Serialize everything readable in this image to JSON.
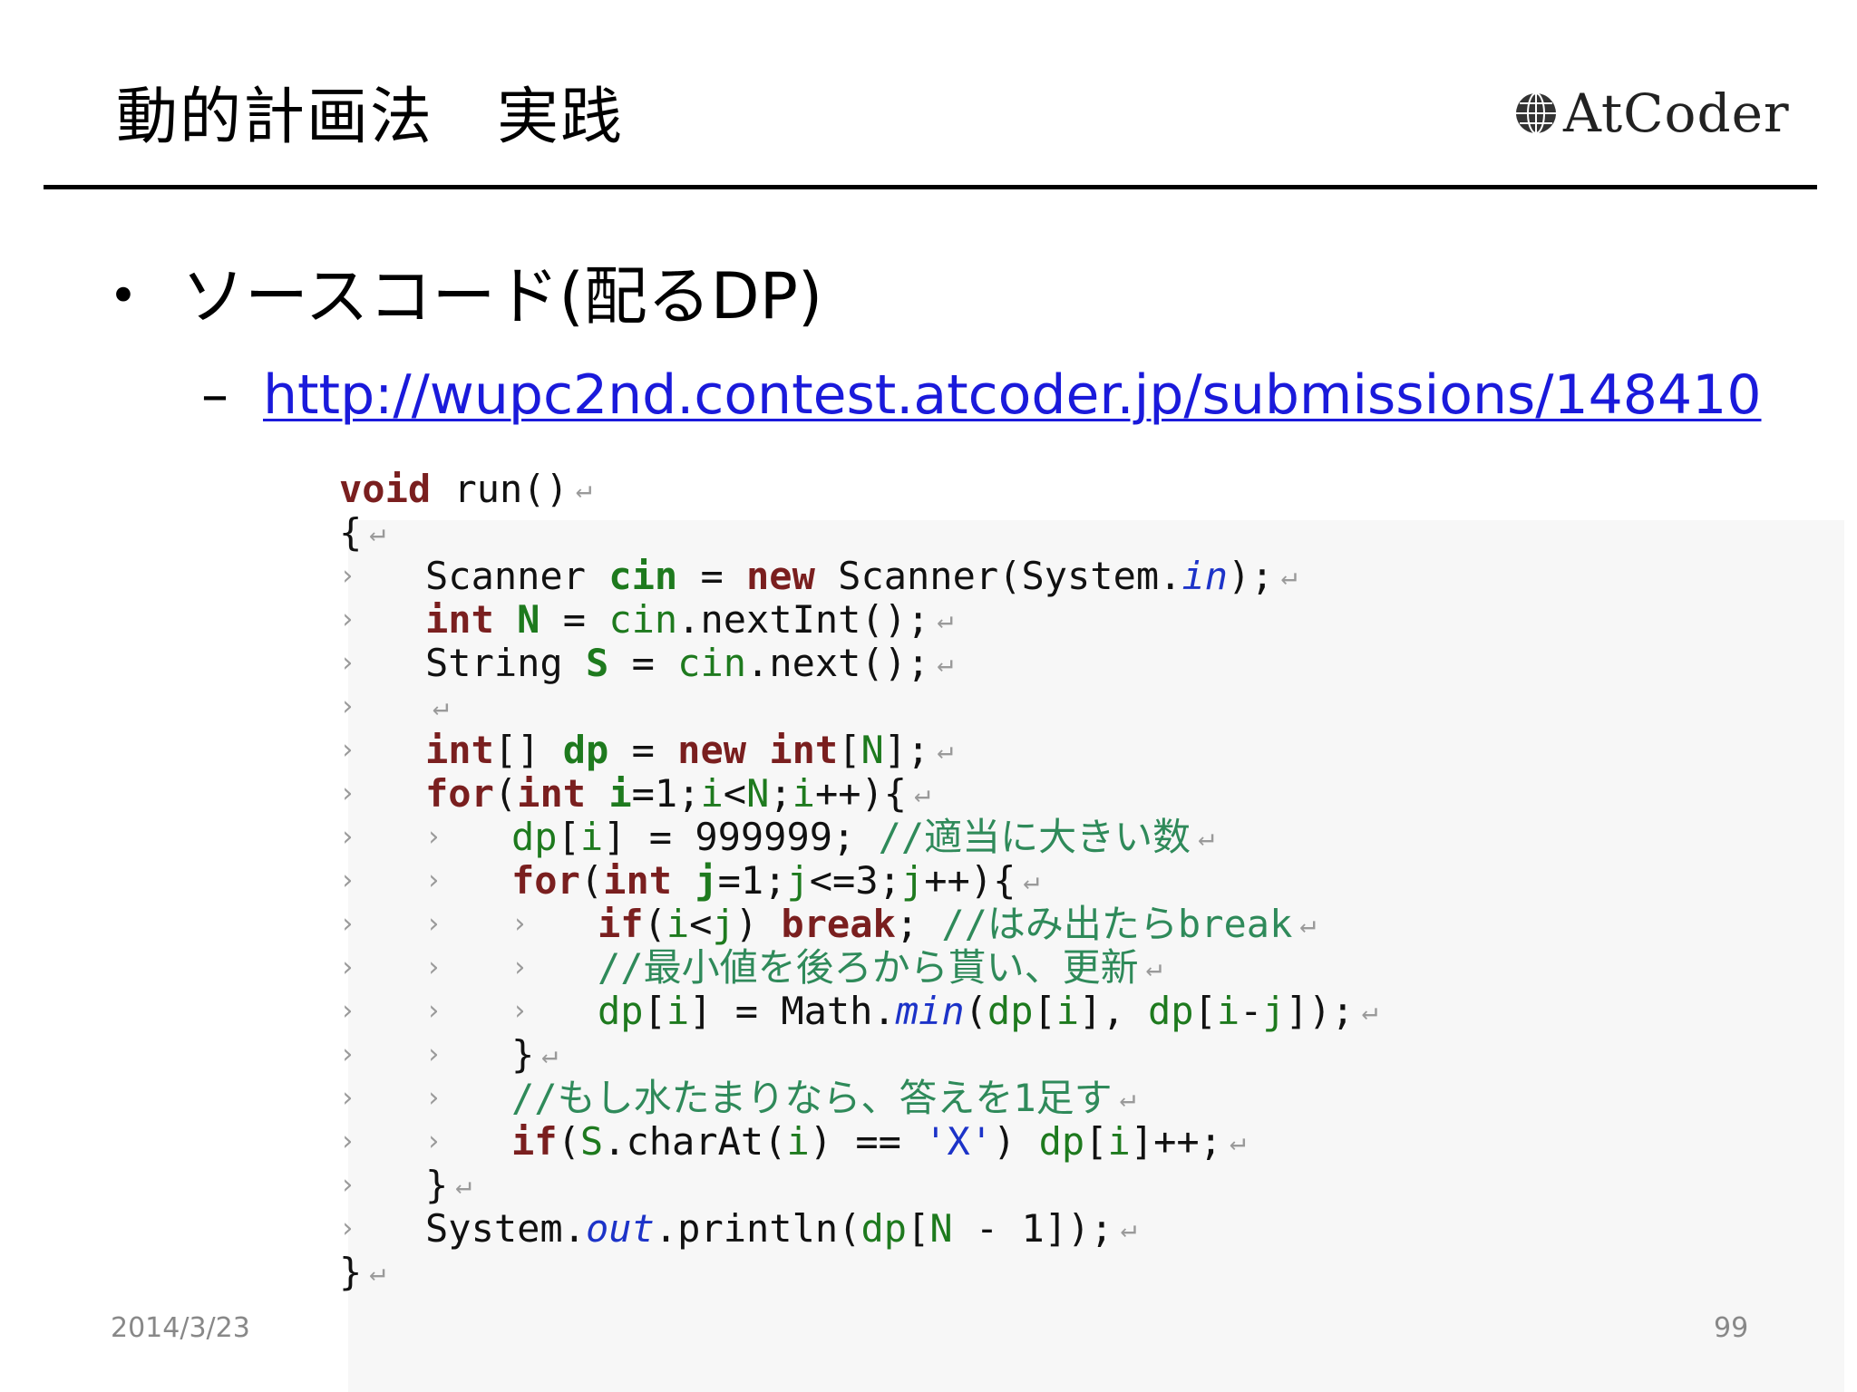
{
  "slide": {
    "title": "動的計画法　実践",
    "logo_text": "AtCoder",
    "bullet": "ソースコード(配るDP)",
    "sub_dash": "–",
    "link": "http://wupc2nd.contest.atcoder.jp/submissions/148410",
    "date": "2014/3/23",
    "page_number": "99"
  },
  "code": {
    "tab_glyph": "›",
    "return_glyph": "↵",
    "lines": [
      {
        "indent": 0,
        "tokens": [
          {
            "t": "void",
            "c": "kw"
          },
          {
            "t": " run()",
            "c": ""
          }
        ]
      },
      {
        "indent": 0,
        "tokens": [
          {
            "t": "{",
            "c": ""
          }
        ]
      },
      {
        "indent": 1,
        "tokens": [
          {
            "t": "Scanner ",
            "c": ""
          },
          {
            "t": "cin",
            "c": "varb"
          },
          {
            "t": " = ",
            "c": ""
          },
          {
            "t": "new",
            "c": "kw"
          },
          {
            "t": " Scanner(System.",
            "c": ""
          },
          {
            "t": "in",
            "c": "stat"
          },
          {
            "t": ");",
            "c": ""
          }
        ]
      },
      {
        "indent": 1,
        "tokens": [
          {
            "t": "int",
            "c": "kw"
          },
          {
            "t": " ",
            "c": ""
          },
          {
            "t": "N",
            "c": "varb"
          },
          {
            "t": " = ",
            "c": ""
          },
          {
            "t": "cin",
            "c": "var"
          },
          {
            "t": ".nextInt();",
            "c": ""
          }
        ]
      },
      {
        "indent": 1,
        "tokens": [
          {
            "t": "String ",
            "c": ""
          },
          {
            "t": "S",
            "c": "varb"
          },
          {
            "t": " = ",
            "c": ""
          },
          {
            "t": "cin",
            "c": "var"
          },
          {
            "t": ".next();",
            "c": ""
          }
        ]
      },
      {
        "indent": 1,
        "tokens": []
      },
      {
        "indent": 1,
        "tokens": [
          {
            "t": "int",
            "c": "kw"
          },
          {
            "t": "[] ",
            "c": ""
          },
          {
            "t": "dp",
            "c": "varb"
          },
          {
            "t": " = ",
            "c": ""
          },
          {
            "t": "new",
            "c": "kw"
          },
          {
            "t": " ",
            "c": ""
          },
          {
            "t": "int",
            "c": "kw"
          },
          {
            "t": "[",
            "c": ""
          },
          {
            "t": "N",
            "c": "var"
          },
          {
            "t": "];",
            "c": ""
          }
        ]
      },
      {
        "indent": 1,
        "tokens": [
          {
            "t": "for",
            "c": "kw"
          },
          {
            "t": "(",
            "c": ""
          },
          {
            "t": "int",
            "c": "kw"
          },
          {
            "t": " ",
            "c": ""
          },
          {
            "t": "i",
            "c": "varb"
          },
          {
            "t": "=1;",
            "c": ""
          },
          {
            "t": "i",
            "c": "var"
          },
          {
            "t": "<",
            "c": ""
          },
          {
            "t": "N",
            "c": "var"
          },
          {
            "t": ";",
            "c": ""
          },
          {
            "t": "i",
            "c": "var"
          },
          {
            "t": "++){",
            "c": ""
          }
        ]
      },
      {
        "indent": 2,
        "tokens": [
          {
            "t": "dp",
            "c": "var"
          },
          {
            "t": "[",
            "c": ""
          },
          {
            "t": "i",
            "c": "var"
          },
          {
            "t": "] = 999999; ",
            "c": ""
          },
          {
            "t": "//適当に大きい数",
            "c": "cmt"
          }
        ]
      },
      {
        "indent": 2,
        "tokens": [
          {
            "t": "for",
            "c": "kw"
          },
          {
            "t": "(",
            "c": ""
          },
          {
            "t": "int",
            "c": "kw"
          },
          {
            "t": " ",
            "c": ""
          },
          {
            "t": "j",
            "c": "varb"
          },
          {
            "t": "=1;",
            "c": ""
          },
          {
            "t": "j",
            "c": "var"
          },
          {
            "t": "<=3;",
            "c": ""
          },
          {
            "t": "j",
            "c": "var"
          },
          {
            "t": "++){",
            "c": ""
          }
        ]
      },
      {
        "indent": 3,
        "tokens": [
          {
            "t": "if",
            "c": "kw"
          },
          {
            "t": "(",
            "c": ""
          },
          {
            "t": "i",
            "c": "var"
          },
          {
            "t": "<",
            "c": ""
          },
          {
            "t": "j",
            "c": "var"
          },
          {
            "t": ") ",
            "c": ""
          },
          {
            "t": "break",
            "c": "kw"
          },
          {
            "t": "; ",
            "c": ""
          },
          {
            "t": "//はみ出たらbreak",
            "c": "cmt"
          }
        ]
      },
      {
        "indent": 3,
        "tokens": [
          {
            "t": "//最小値を後ろから貰い、更新",
            "c": "cmt"
          }
        ]
      },
      {
        "indent": 3,
        "tokens": [
          {
            "t": "dp",
            "c": "var"
          },
          {
            "t": "[",
            "c": ""
          },
          {
            "t": "i",
            "c": "var"
          },
          {
            "t": "] = Math.",
            "c": ""
          },
          {
            "t": "min",
            "c": "stat"
          },
          {
            "t": "(",
            "c": ""
          },
          {
            "t": "dp",
            "c": "var"
          },
          {
            "t": "[",
            "c": ""
          },
          {
            "t": "i",
            "c": "var"
          },
          {
            "t": "], ",
            "c": ""
          },
          {
            "t": "dp",
            "c": "var"
          },
          {
            "t": "[",
            "c": ""
          },
          {
            "t": "i",
            "c": "var"
          },
          {
            "t": "-",
            "c": ""
          },
          {
            "t": "j",
            "c": "var"
          },
          {
            "t": "]);",
            "c": ""
          }
        ]
      },
      {
        "indent": 2,
        "tokens": [
          {
            "t": "}",
            "c": ""
          }
        ]
      },
      {
        "indent": 2,
        "tokens": [
          {
            "t": "//もし水たまりなら、答えを1足す",
            "c": "cmt"
          }
        ]
      },
      {
        "indent": 2,
        "tokens": [
          {
            "t": "if",
            "c": "kw"
          },
          {
            "t": "(",
            "c": ""
          },
          {
            "t": "S",
            "c": "var"
          },
          {
            "t": ".charAt(",
            "c": ""
          },
          {
            "t": "i",
            "c": "var"
          },
          {
            "t": ") == ",
            "c": ""
          },
          {
            "t": "'X'",
            "c": "str"
          },
          {
            "t": ") ",
            "c": ""
          },
          {
            "t": "dp",
            "c": "var"
          },
          {
            "t": "[",
            "c": ""
          },
          {
            "t": "i",
            "c": "var"
          },
          {
            "t": "]++;",
            "c": ""
          }
        ]
      },
      {
        "indent": 1,
        "tokens": [
          {
            "t": "}",
            "c": ""
          }
        ]
      },
      {
        "indent": 1,
        "tokens": [
          {
            "t": "System.",
            "c": ""
          },
          {
            "t": "out",
            "c": "stat"
          },
          {
            "t": ".println(",
            "c": ""
          },
          {
            "t": "dp",
            "c": "var"
          },
          {
            "t": "[",
            "c": ""
          },
          {
            "t": "N",
            "c": "var"
          },
          {
            "t": " - 1]);",
            "c": ""
          }
        ]
      },
      {
        "indent": 0,
        "tokens": [
          {
            "t": "}",
            "c": ""
          }
        ]
      }
    ]
  }
}
